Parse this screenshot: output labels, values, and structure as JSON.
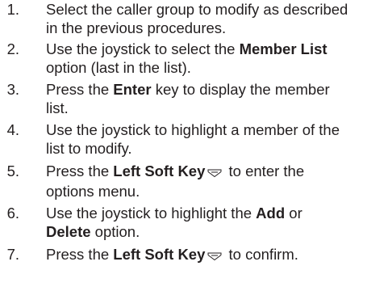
{
  "steps": [
    {
      "number": "1.",
      "lines": [
        [
          "Select the caller group to modify as described"
        ],
        [
          "in the previous procedures."
        ]
      ]
    },
    {
      "number": "2.",
      "lines": [
        [
          "Use the joystick to select the ",
          "Member List"
        ],
        [
          "option (last in the list)."
        ]
      ]
    },
    {
      "number": "3.",
      "lines": [
        [
          "Press the ",
          "Enter",
          " key to display the member"
        ],
        [
          "list."
        ]
      ]
    },
    {
      "number": "4.",
      "lines": [
        [
          "Use the joystick to highlight a member of the"
        ],
        [
          "list to modify."
        ]
      ]
    },
    {
      "number": "5.",
      "lines": [
        [
          "Press the ",
          "Left Soft Key",
          " to enter the"
        ],
        [
          "options menu."
        ]
      ]
    },
    {
      "number": "6.",
      "lines": [
        [
          "Use the joystick to highlight the ",
          "Add",
          " or"
        ],
        [
          "Delete",
          " option."
        ]
      ]
    },
    {
      "number": "7.",
      "lines": [
        [
          "Press the ",
          "Left Soft Key",
          " to confirm."
        ]
      ]
    }
  ],
  "icons": {
    "soft_key": "left-soft-key-icon"
  }
}
